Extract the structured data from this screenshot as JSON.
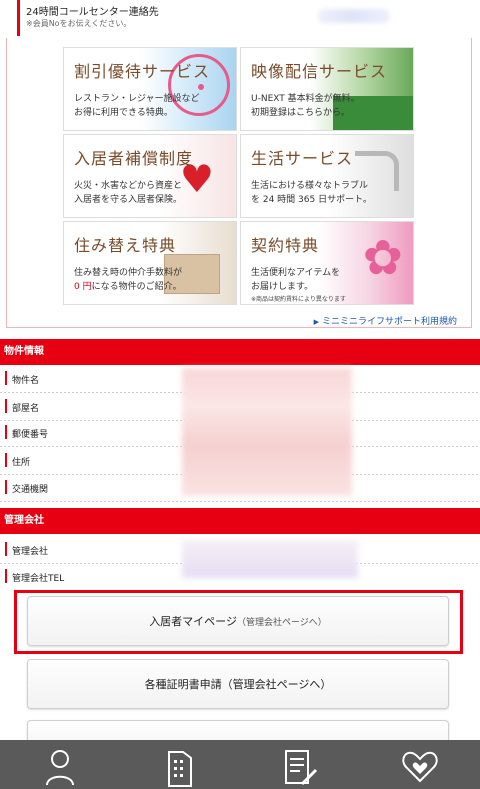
{
  "callcenter": {
    "title": "24時間コールセンター連絡先",
    "note": "※会員Noをお伝えください。"
  },
  "benefits": {
    "tiles": [
      {
        "title": "割引優待サービス",
        "desc1": "レストラン・レジャー施設など",
        "desc2": "お得に利用できる特典。"
      },
      {
        "title": "映像配信サービス",
        "desc1": "U-NEXT 基本料金が無料。",
        "desc2": "初期登録はこちらから。"
      },
      {
        "title": "入居者補償制度",
        "desc1": "火災・水害などから資産と",
        "desc2": "入居者を守る入居者保険。"
      },
      {
        "title": "生活サービス",
        "desc1": "生活における様々なトラブル",
        "desc2": "を 24 時間 365 日サポート。"
      },
      {
        "title": "住み替え特典",
        "desc1": "住み替え時の仲介手数料が",
        "desc2_red": "0 円",
        "desc2": "になる物件のご紹介。"
      },
      {
        "title": "契約特典",
        "desc1": "生活便利なアイテムを",
        "desc2": "お届けします。",
        "note": "※商品は契約賃料により異なります"
      }
    ],
    "support_link": "ミニミニライフサポート利用規約"
  },
  "property": {
    "header": "物件情報",
    "rows": [
      "物件名",
      "部屋名",
      "郵便番号",
      "住所",
      "交通機関"
    ]
  },
  "management": {
    "header": "管理会社",
    "rows": [
      "管理会社",
      "管理会社TEL"
    ]
  },
  "buttons": {
    "mypage_label": "入居者マイページ",
    "mypage_sub": "（管理会社ページへ）",
    "certificate_label": "各種証明書申請（管理会社ページへ）"
  },
  "bottom_nav": {
    "items": [
      {
        "icon": "person-icon"
      },
      {
        "icon": "building-icon"
      },
      {
        "icon": "document-pen-icon"
      },
      {
        "icon": "heart-hands-icon"
      }
    ]
  },
  "colors": {
    "accent": "#e60012",
    "link": "#1a56b0",
    "nav_bg": "#5a5a5a"
  }
}
